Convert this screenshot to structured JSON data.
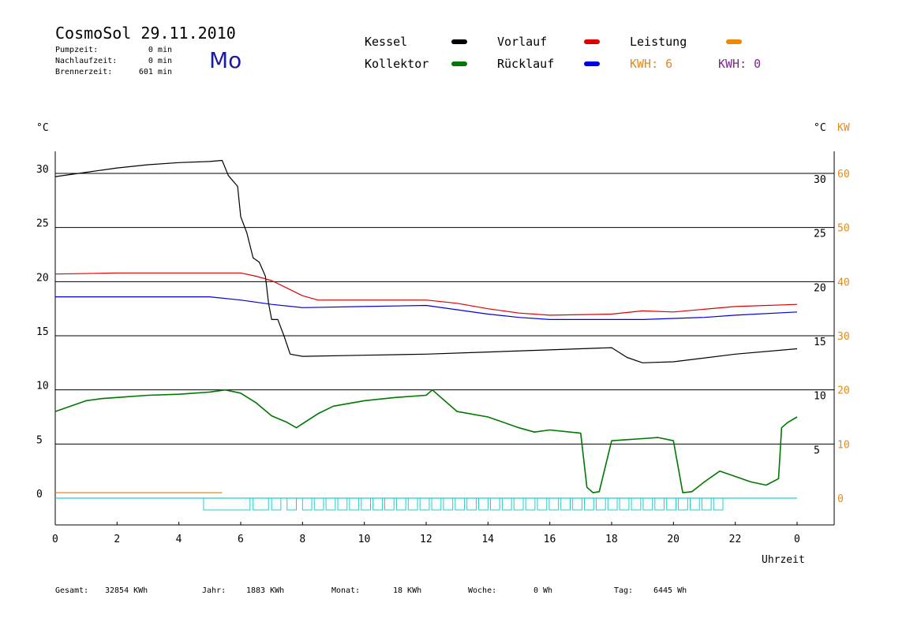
{
  "header": {
    "app_title": "CosmoSol 29.11.2010",
    "day_of_week": "Mo",
    "pumpzeit_label": "Pumpzeit:",
    "pumpzeit_value": "0 min",
    "nachlaufzeit_label": "Nachlaufzeit:",
    "nachlaufzeit_value": "0 min",
    "brennerzeit_label": "Brennerzeit:",
    "brennerzeit_value": "601 min"
  },
  "legend": {
    "kessel": "Kessel",
    "vorlauf": "Vorlauf",
    "leistung": "Leistung",
    "kollektor": "Kollektor",
    "ruecklauf": "Rücklauf",
    "kwh_orange": "KWH: 6",
    "kwh_purple": "KWH: 0"
  },
  "colors": {
    "kessel": "#000000",
    "vorlauf": "#dd0000",
    "ruecklauf": "#0000dd",
    "kollektor": "#007700",
    "leistung": "#ee8800",
    "kw_axis": "#e08a1e",
    "kwh_purple": "#7a2a8a",
    "pump": "#22cccc",
    "grid": "#000000"
  },
  "footer": {
    "gesamt_label": "Gesamt:",
    "gesamt_value": "32854 KWh",
    "jahr_label": "Jahr:",
    "jahr_value": "1883 KWh",
    "monat_label": "Monat:",
    "monat_value": "18 KWh",
    "woche_label": "Woche:",
    "woche_value": "0 Wh",
    "tag_label": "Tag:",
    "tag_value": "6445 Wh"
  },
  "chart_data": {
    "type": "line",
    "xlabel": "Uhrzeit",
    "ylabel_left": "°C",
    "ylabel_right": "°C",
    "ylabel_right2": "KW",
    "x_ticks": [
      "0",
      "2",
      "4",
      "6",
      "8",
      "10",
      "12",
      "14",
      "16",
      "18",
      "20",
      "22",
      "0"
    ],
    "y_ticks_left": [
      "0",
      "5",
      "10",
      "15",
      "20",
      "25",
      "30"
    ],
    "y_ticks_right": [
      "5",
      "10",
      "15",
      "20",
      "25",
      "30"
    ],
    "y_ticks_kw": [
      "0",
      "10",
      "20",
      "30",
      "40",
      "50",
      "60"
    ],
    "xlim": [
      0,
      24
    ],
    "ylim": [
      0,
      32
    ],
    "series": [
      {
        "name": "Kessel",
        "x": [
          0,
          1,
          2,
          3,
          4,
          5,
          5.4,
          5.6,
          5.9,
          6.0,
          6.2,
          6.4,
          6.6,
          6.8,
          6.9,
          7.0,
          7.2,
          7.4,
          7.6,
          8.0,
          10,
          12,
          14,
          16,
          18,
          18.5,
          19,
          20,
          22,
          24
        ],
        "y": [
          29.7,
          30.1,
          30.5,
          30.8,
          31.0,
          31.1,
          31.2,
          29.8,
          28.8,
          26.0,
          24.5,
          22.2,
          21.8,
          20.5,
          18.0,
          16.5,
          16.5,
          15.0,
          13.3,
          13.1,
          13.2,
          13.3,
          13.5,
          13.7,
          13.9,
          13.0,
          12.5,
          12.6,
          13.3,
          13.8
        ]
      },
      {
        "name": "Vorlauf",
        "x": [
          0,
          2,
          4,
          6,
          6.5,
          7,
          7.5,
          8,
          8.5,
          10,
          12,
          13,
          14,
          15,
          16,
          18,
          19,
          20,
          22,
          24
        ],
        "y": [
          20.7,
          20.8,
          20.8,
          20.8,
          20.5,
          20.1,
          19.4,
          18.7,
          18.3,
          18.3,
          18.3,
          18.0,
          17.5,
          17.1,
          16.9,
          17.0,
          17.3,
          17.2,
          17.7,
          17.9
        ]
      },
      {
        "name": "Rücklauf",
        "x": [
          0,
          2,
          5,
          6,
          7,
          8,
          10,
          12,
          13,
          14,
          15,
          16,
          17,
          18,
          19,
          20,
          21,
          22,
          24
        ],
        "y": [
          18.6,
          18.6,
          18.6,
          18.3,
          17.9,
          17.6,
          17.7,
          17.8,
          17.4,
          17.0,
          16.7,
          16.5,
          16.5,
          16.5,
          16.5,
          16.6,
          16.7,
          16.9,
          17.2
        ]
      },
      {
        "name": "Kollektor",
        "x": [
          0,
          0.5,
          1,
          1.5,
          2,
          3,
          4,
          5,
          5.5,
          6,
          6.5,
          7,
          7.5,
          7.8,
          8.5,
          9,
          10,
          11,
          12,
          12.2,
          13,
          14,
          15,
          15.5,
          16,
          17,
          17.2,
          17.4,
          17.6,
          18,
          18.5,
          19,
          19.5,
          20,
          20.3,
          20.6,
          21,
          21.5,
          22,
          22.5,
          23,
          23.4,
          23.5,
          23.7,
          24
        ],
        "y": [
          8.0,
          8.5,
          9.0,
          9.2,
          9.3,
          9.5,
          9.6,
          9.8,
          10.0,
          9.7,
          8.8,
          7.6,
          7.0,
          6.5,
          7.8,
          8.5,
          9.0,
          9.3,
          9.5,
          10.0,
          8.0,
          7.5,
          6.5,
          6.1,
          6.3,
          6.0,
          1.0,
          0.5,
          0.6,
          5.3,
          5.4,
          5.5,
          5.6,
          5.3,
          0.5,
          0.6,
          1.5,
          2.5,
          2.0,
          1.5,
          1.2,
          1.8,
          6.5,
          7.0,
          7.5
        ]
      },
      {
        "name": "Leistung",
        "x": [
          0,
          5.4
        ],
        "y": [
          0.5,
          0.5
        ]
      },
      {
        "name": "Pumpe",
        "x": [
          0,
          24
        ],
        "y": [
          0,
          0
        ]
      }
    ]
  }
}
